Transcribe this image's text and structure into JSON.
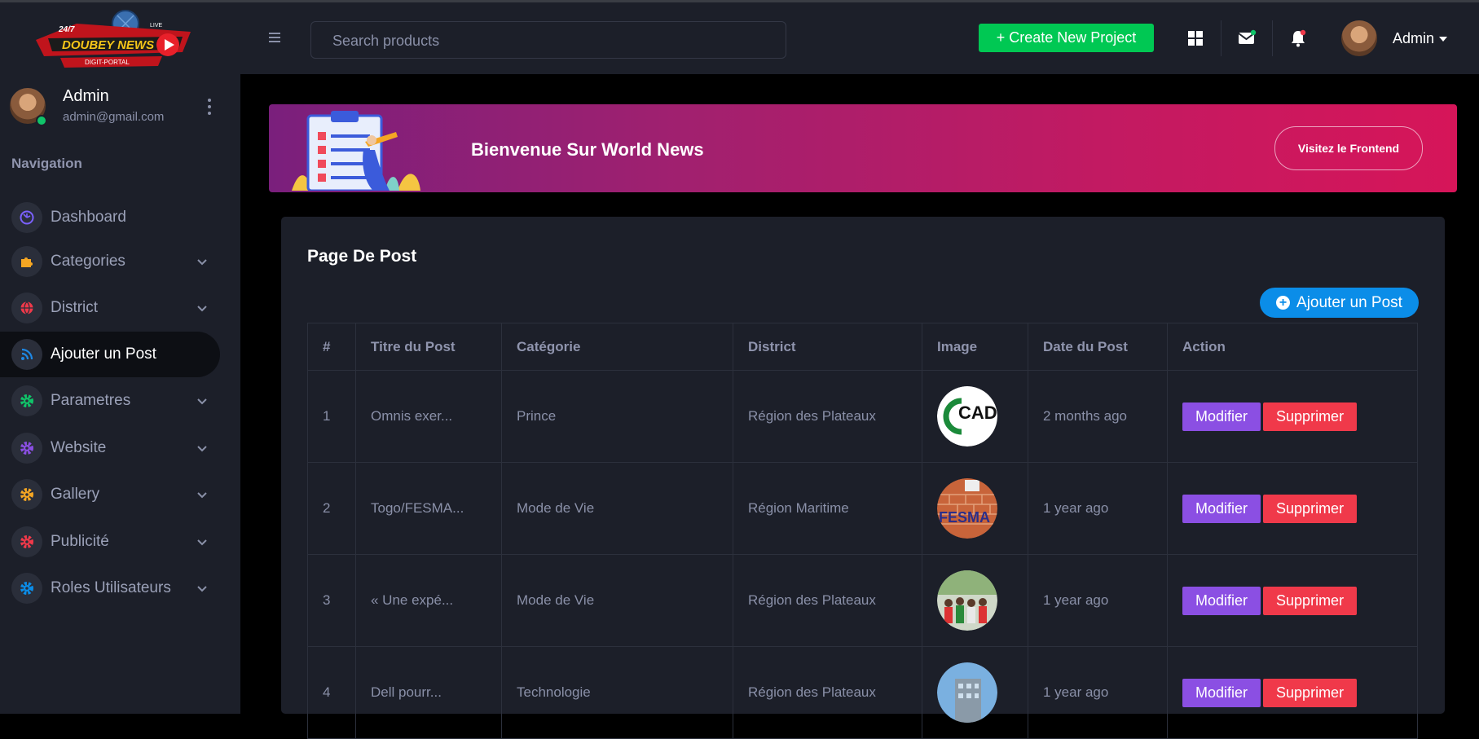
{
  "app": {
    "logo_text": "DOUBEY NEWS",
    "logo_badge_left": "24/7",
    "logo_badge_right": "LIVE",
    "logo_sub": "DIGIT-PORTAL"
  },
  "user": {
    "name": "Admin",
    "email": "admin@gmail.com"
  },
  "sidebar": {
    "title": "Navigation",
    "items": [
      {
        "label": "Dashboard",
        "icon": "dashboard-icon",
        "color": "#7b61ff",
        "expandable": false
      },
      {
        "label": "Categories",
        "icon": "puzzle-icon",
        "color": "#f5a623",
        "expandable": true
      },
      {
        "label": "District",
        "icon": "globe-icon",
        "color": "#f0394a",
        "expandable": true
      },
      {
        "label": "Ajouter un Post",
        "icon": "post-icon",
        "color": "#1e88e5",
        "expandable": false,
        "active": true
      },
      {
        "label": "Parametres",
        "icon": "gear-icon",
        "color": "#10c469",
        "expandable": true
      },
      {
        "label": "Website",
        "icon": "gear-icon",
        "color": "#8b4fe3",
        "expandable": true
      },
      {
        "label": "Gallery",
        "icon": "gear-icon",
        "color": "#f5a623",
        "expandable": true
      },
      {
        "label": "Publicité",
        "icon": "gear-icon",
        "color": "#f0394a",
        "expandable": true
      },
      {
        "label": "Roles Utilisateurs",
        "icon": "gear-icon",
        "color": "#0b8de8",
        "expandable": true
      }
    ]
  },
  "header": {
    "search_placeholder": "Search products",
    "create_button": "+ Create New Project",
    "admin_label": "Admin"
  },
  "banner": {
    "title": "Bienvenue Sur World News",
    "button": "Visitez le Frontend"
  },
  "card": {
    "title": "Page De Post",
    "add_button": "Ajouter un Post",
    "columns": [
      "#",
      "Titre du Post",
      "Catégorie",
      "District",
      "Image",
      "Date du Post",
      "Action"
    ],
    "rows": [
      {
        "num": "1",
        "title": "Omnis exer...",
        "category": "Prince",
        "district": "Région des Plateaux",
        "image_text": "CAD",
        "date": "2 months ago"
      },
      {
        "num": "2",
        "title": "Togo/FESMA...",
        "category": "Mode de Vie",
        "district": "Région Maritime",
        "image_text": "FESMA",
        "date": "1 year ago"
      },
      {
        "num": "3",
        "title": "« Une expé...",
        "category": "Mode de Vie",
        "district": "Région des Plateaux",
        "image_text": "",
        "date": "1 year ago"
      },
      {
        "num": "4",
        "title": "Dell pourr...",
        "category": "Technologie",
        "district": "Région des Plateaux",
        "image_text": "",
        "date": "1 year ago"
      }
    ],
    "edit_label": "Modifier",
    "delete_label": "Supprimer"
  },
  "colors": {
    "success": "#00c853",
    "primary": "#0b8de8",
    "purple": "#8b4fe3",
    "danger": "#f0394a"
  }
}
